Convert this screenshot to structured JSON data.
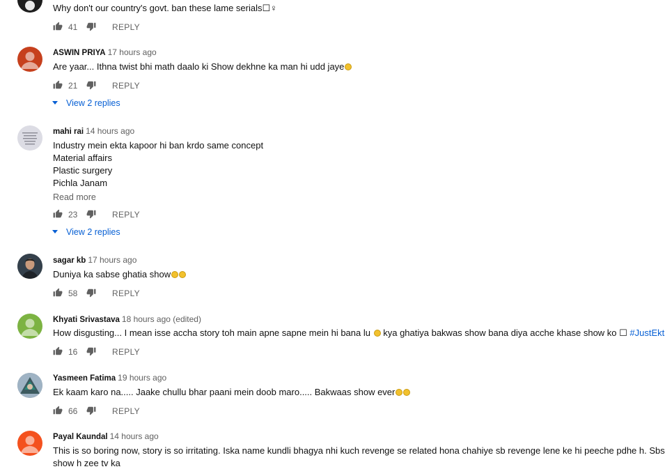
{
  "comments": [
    {
      "author": "",
      "time": "",
      "text": "Why don't our country's govt. ban these lame serials☐♀",
      "likes": "41",
      "reply_label": "REPLY"
    },
    {
      "author": "ASWIN PRIYA",
      "time": "17 hours ago",
      "text": "Are yaar... Ithna twist bhi math daalo ki Show dekhne ka man hi udd jaye",
      "likes": "21",
      "reply_label": "REPLY",
      "view_replies": "View 2 replies"
    },
    {
      "author": "mahi rai",
      "time": "14 hours ago",
      "lines": [
        "Industry mein ekta kapoor  hi ban krdo same concept",
        "Material affairs",
        "Plastic surgery",
        "Pichla Janam"
      ],
      "read_more": "Read more",
      "likes": "23",
      "reply_label": "REPLY",
      "view_replies": "View 2 replies"
    },
    {
      "author": "sagar kb",
      "time": "17 hours ago",
      "text": "Duniya ka sabse ghatia show",
      "likes": "58",
      "reply_label": "REPLY"
    },
    {
      "author": "Khyati Srivastava",
      "time": "18 hours ago (edited)",
      "text_a": "How disgusting... I mean isse accha story toh main apne sapne mein hi bana lu",
      "text_b": " kya ghatiya bakwas show bana diya acche khase show ko ☐ ",
      "hashtag": "#JustEktaKapo",
      "likes": "16",
      "reply_label": "REPLY"
    },
    {
      "author": "Yasmeen Fatima",
      "time": "19 hours ago",
      "text": "Ek kaam karo na..... Jaake chullu bhar paani mein doob maro..... Bakwaas show ever",
      "likes": "66",
      "reply_label": "REPLY"
    },
    {
      "author": "Payal Kaundal",
      "time": "14 hours ago",
      "lines": [
        "This is so boring now, story is so irritating. Iska name kundli bhagya nhi kuch revenge se related hona chahiye sb revenge lene ke hi peeche pdhe h. Sbse borin",
        "show h zee tv ka"
      ]
    }
  ],
  "avatars": {
    "aswin": "#c6401d",
    "khyati": "#7cb342",
    "payal": "#f4511e"
  }
}
